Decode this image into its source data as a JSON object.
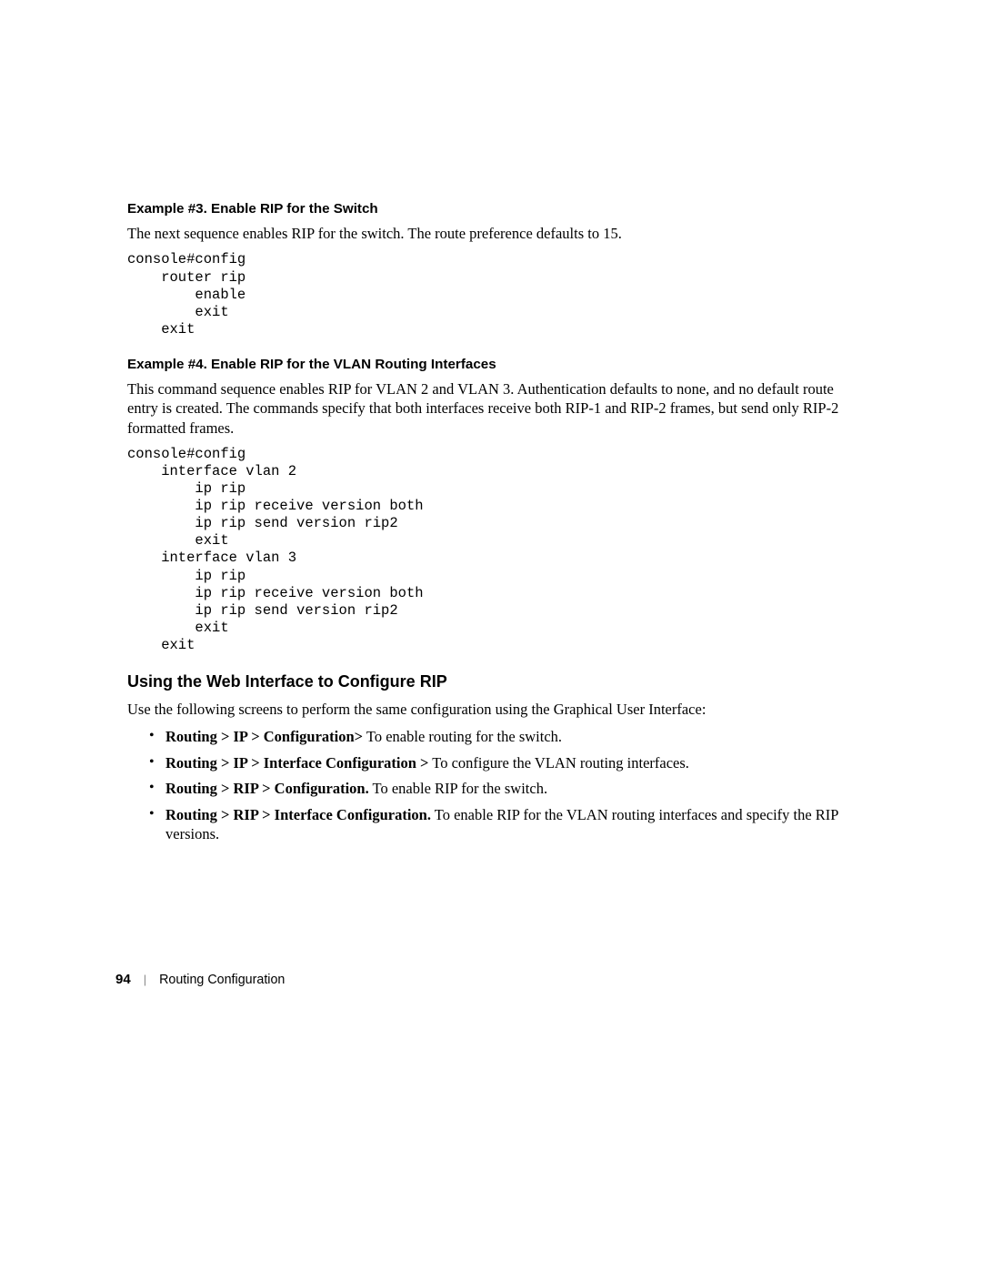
{
  "example3": {
    "heading": "Example #3. Enable RIP for the Switch",
    "intro": "The next sequence enables RIP for the switch. The route preference defaults to 15.",
    "code": "console#config\n    router rip\n        enable\n        exit\n    exit"
  },
  "example4": {
    "heading": "Example #4. Enable RIP for the VLAN Routing Interfaces",
    "intro": "This command sequence enables RIP for VLAN 2 and VLAN 3. Authentication defaults to none, and no default route entry is created. The commands specify that both interfaces receive both RIP-1 and RIP-2 frames, but send only RIP-2 formatted frames.",
    "code": "console#config\n    interface vlan 2\n        ip rip\n        ip rip receive version both\n        ip rip send version rip2\n        exit\n    interface vlan 3\n        ip rip\n        ip rip receive version both\n        ip rip send version rip2\n        exit\n    exit"
  },
  "webSection": {
    "heading": "Using the Web Interface to Configure RIP",
    "intro": "Use the following screens to perform the same configuration using the Graphical User Interface:",
    "bullets": [
      {
        "bold": "Routing > IP > Configuration>",
        "rest": " To enable routing for the switch."
      },
      {
        "bold": "Routing > IP > Interface Configuration >",
        "rest": " To configure the VLAN routing interfaces."
      },
      {
        "bold": "Routing > RIP > Configuration.",
        "rest": " To enable RIP for the switch."
      },
      {
        "bold": "Routing > RIP > Interface Configuration.",
        "rest": " To enable RIP for the VLAN routing interfaces and specify the RIP versions."
      }
    ]
  },
  "footer": {
    "pageNumber": "94",
    "title": "Routing Configuration"
  }
}
